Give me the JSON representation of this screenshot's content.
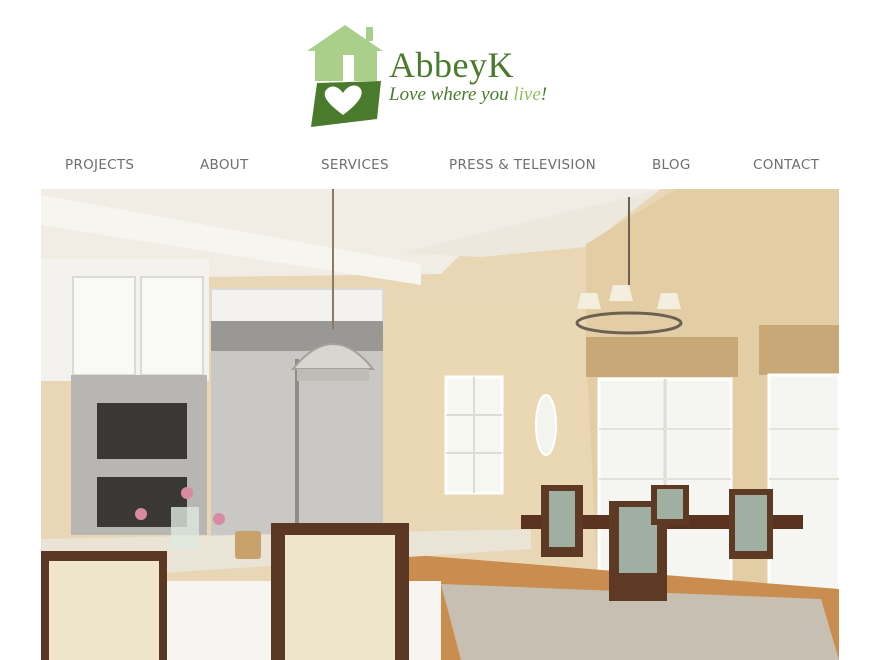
{
  "logo": {
    "brand": "AbbeyK",
    "tagline_main": "Love where you ",
    "tagline_accent": "live",
    "tagline_end": "!"
  },
  "nav": {
    "items": [
      {
        "label": "PROJECTS"
      },
      {
        "label": "ABOUT"
      },
      {
        "label": "SERVICES"
      },
      {
        "label": "PRESS & TELEVISION"
      },
      {
        "label": "BLOG"
      },
      {
        "label": "CONTACT"
      }
    ]
  },
  "colors": {
    "brand_green": "#4a7a2c",
    "brand_light_green": "#a9cf8a",
    "nav_text": "#6e6e6e"
  },
  "hero": {
    "alt_subject": "kitchen and dining room interior"
  }
}
